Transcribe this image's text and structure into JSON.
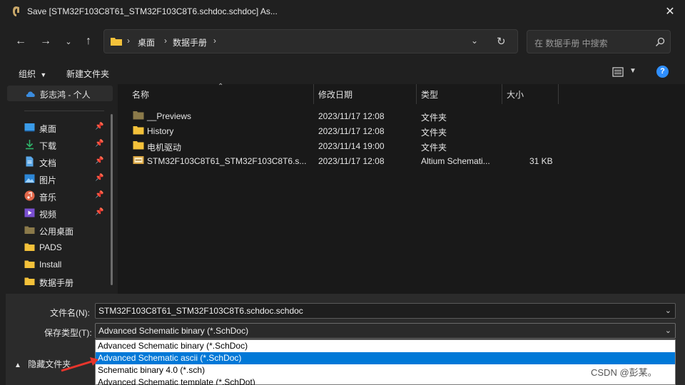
{
  "window": {
    "title": "Save [STM32F103C8T61_STM32F103C8T6.schdoc.schdoc] As..."
  },
  "address": {
    "breadcrumbs": [
      "桌面",
      "数据手册"
    ]
  },
  "search": {
    "placeholder": "在 数据手册 中搜索"
  },
  "toolbar": {
    "organize_label": "组织",
    "new_folder_label": "新建文件夹"
  },
  "sidebar": {
    "cloud_label": "彭志鸿 - 个人",
    "items": [
      {
        "label": "桌面",
        "icon": "desktop-icon",
        "pinned": true
      },
      {
        "label": "下载",
        "icon": "download-icon",
        "pinned": true
      },
      {
        "label": "文档",
        "icon": "document-icon",
        "pinned": true
      },
      {
        "label": "图片",
        "icon": "pictures-icon",
        "pinned": true
      },
      {
        "label": "音乐",
        "icon": "music-icon",
        "pinned": true
      },
      {
        "label": "视频",
        "icon": "video-icon",
        "pinned": true
      },
      {
        "label": "公用桌面",
        "icon": "folder-icon",
        "pinned": false
      },
      {
        "label": "PADS",
        "icon": "folder-icon",
        "pinned": false
      },
      {
        "label": "Install",
        "icon": "folder-icon",
        "pinned": false
      },
      {
        "label": "数据手册",
        "icon": "folder-icon",
        "pinned": false
      }
    ]
  },
  "filelist": {
    "columns": [
      "名称",
      "修改日期",
      "类型",
      "大小"
    ],
    "rows": [
      {
        "name": "__Previews",
        "date": "2023/11/17 12:08",
        "type": "文件夹",
        "size": "",
        "icon": "folder-dim-icon"
      },
      {
        "name": "History",
        "date": "2023/11/17 12:08",
        "type": "文件夹",
        "size": "",
        "icon": "folder-icon"
      },
      {
        "name": "电机驱动",
        "date": "2023/11/14 19:00",
        "type": "文件夹",
        "size": "",
        "icon": "folder-icon"
      },
      {
        "name": "STM32F103C8T61_STM32F103C8T6.s...",
        "date": "2023/11/17 12:08",
        "type": "Altium Schemati...",
        "size": "31 KB",
        "icon": "schdoc-file-icon"
      }
    ]
  },
  "save": {
    "filename_label": "文件名(N):",
    "filename_value": "STM32F103C8T61_STM32F103C8T6.schdoc.schdoc",
    "type_label": "保存类型(T):",
    "type_value": "Advanced Schematic binary (*.SchDoc)",
    "type_options": [
      "Advanced Schematic binary (*.SchDoc)",
      "Advanced Schematic ascii (*.SchDoc)",
      "Schematic binary 4.0 (*.sch)",
      "Advanced Schematic template (*.SchDot)"
    ],
    "selected_option_index": 1,
    "hide_folders_label": "隐藏文件夹"
  },
  "watermark": "CSDN @彭某。",
  "colors": {
    "background": "#202020",
    "selection": "#0078d7",
    "folder": "#f3c13a",
    "accent_arrow": "#e8352c"
  }
}
